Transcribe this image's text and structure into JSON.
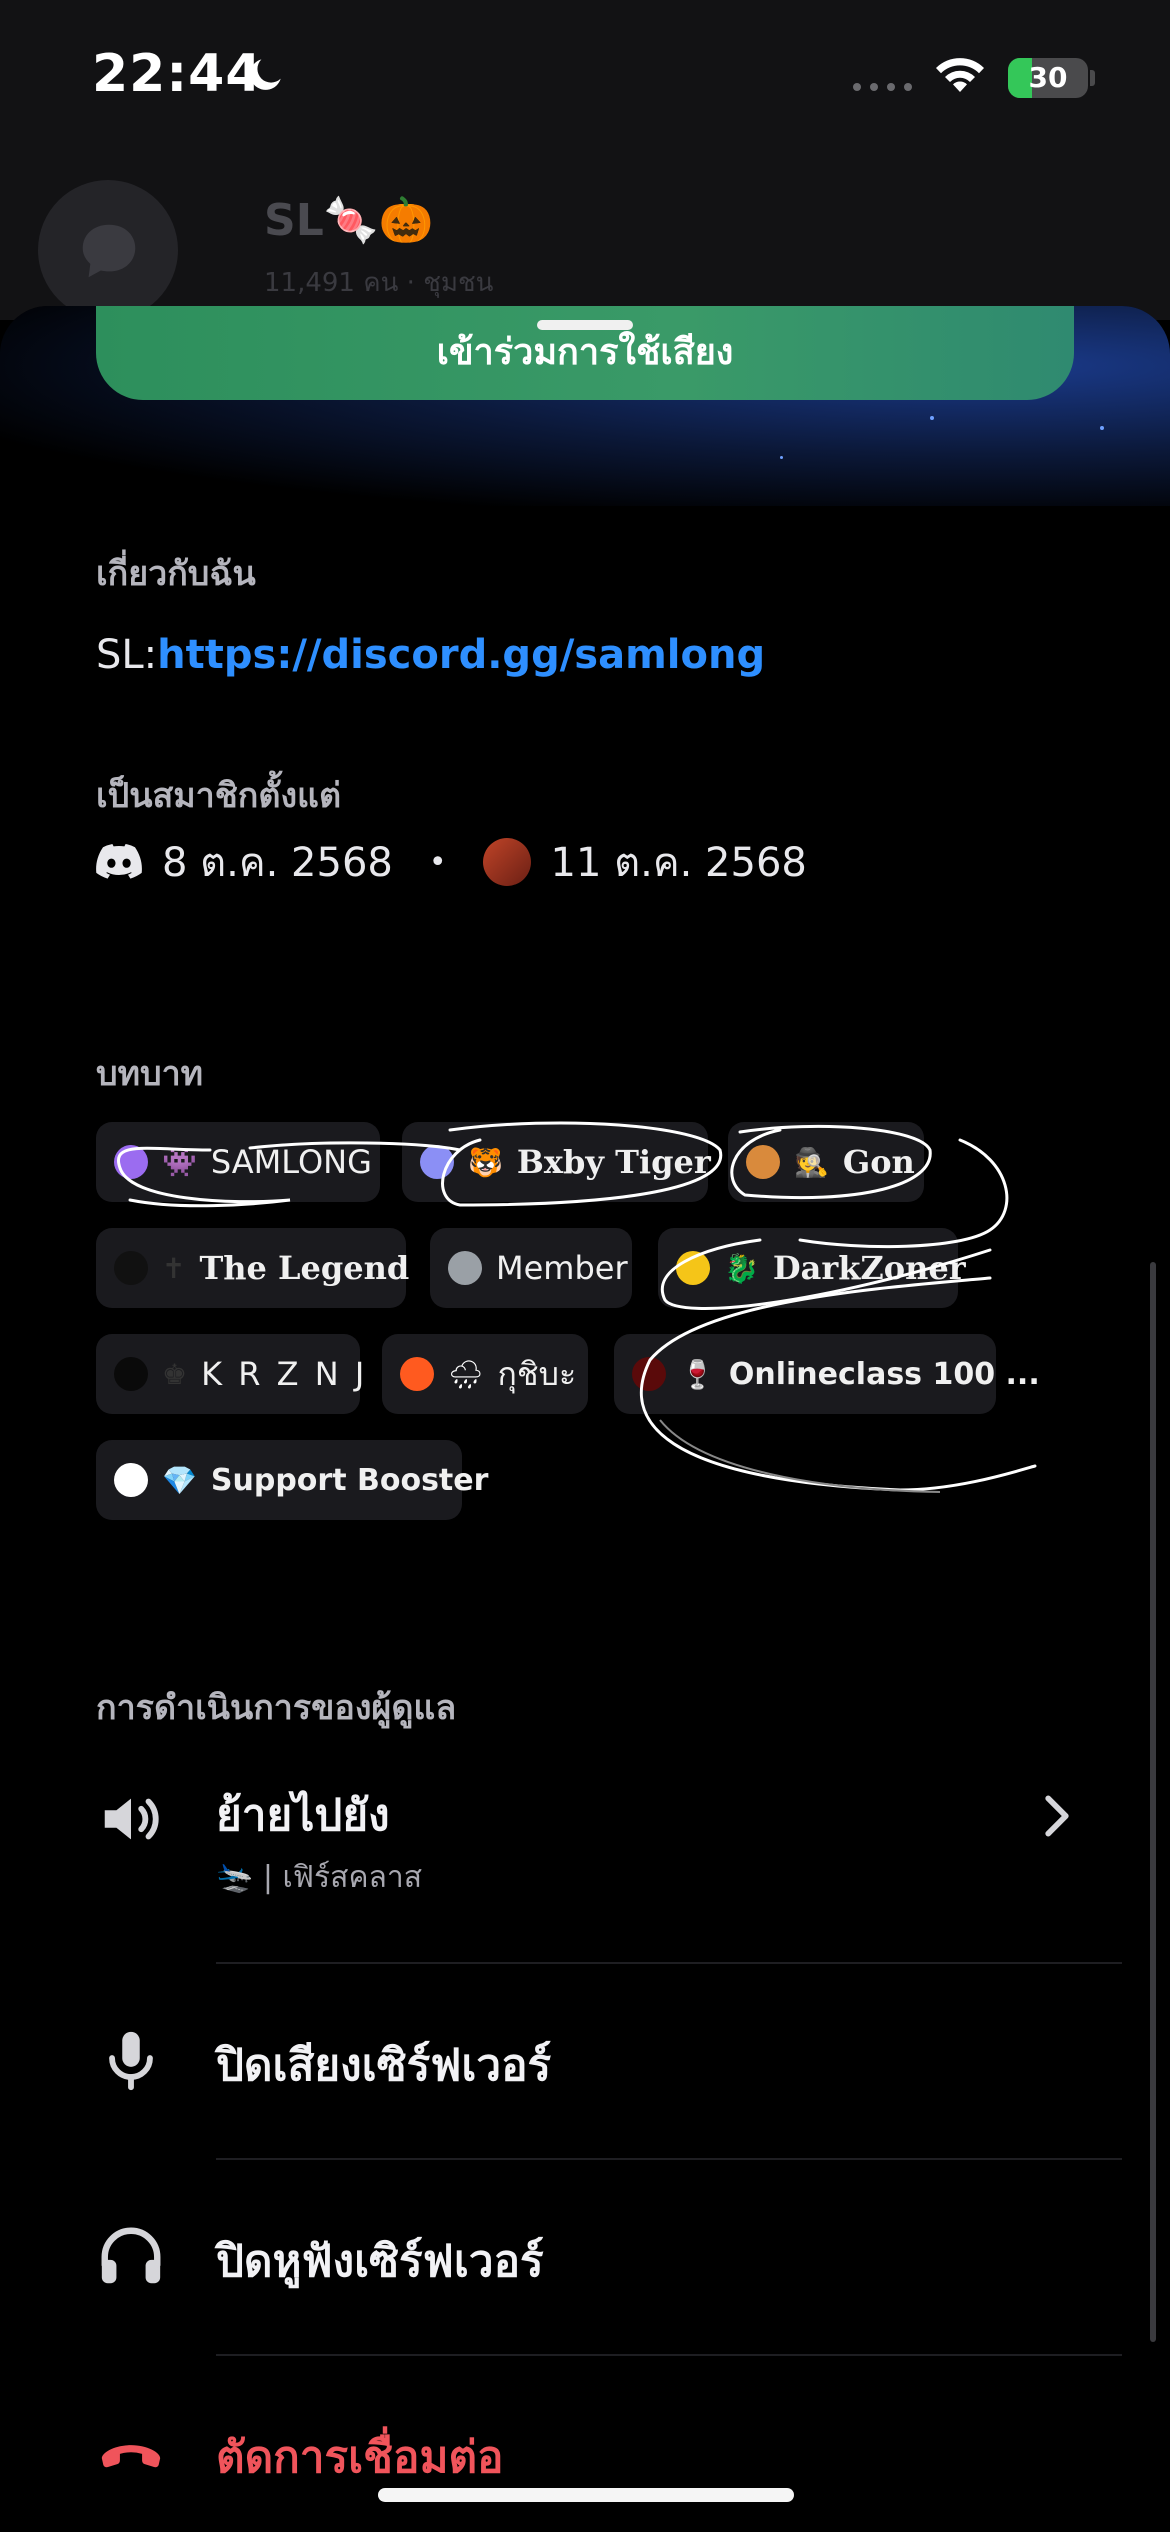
{
  "status_bar": {
    "time": "22:44",
    "battery": "30",
    "battery_level": 0.3
  },
  "background_server": {
    "name": "SL🍬🎃",
    "member_count": "11,491 คน",
    "type": "ชุมชน"
  },
  "join_voice_label": "เข้าร่วมการใช้เสียง",
  "about": {
    "label": "เกี่ยวกับฉัน",
    "prefix": "SL:",
    "link": "https://discord.gg/samlong"
  },
  "member_since": {
    "label": "เป็นสมาชิกตั้งแต่",
    "discord_date": "8 ต.ค. 2568",
    "separator": "•",
    "server_date": "11 ต.ค. 2568"
  },
  "roles": {
    "label": "บทบาท",
    "items": [
      {
        "name": "SAMLONG",
        "color": "#9b6cf0",
        "emoji": "👾"
      },
      {
        "name": "Bxby Tiger",
        "color": "#8b8ff5",
        "emoji": "🐯"
      },
      {
        "name": "Gon",
        "color": "#d98a3c",
        "emoji": "🕵️"
      },
      {
        "name": "The Legend",
        "color": "#111111",
        "emoji": "✝"
      },
      {
        "name": "Member",
        "color": "#9aa0a6",
        "emoji": ""
      },
      {
        "name": "DarkZoner",
        "color": "#f5c518",
        "emoji": "🐉"
      },
      {
        "name": "K R Z N J",
        "color": "#0a0a0a",
        "emoji": "♚"
      },
      {
        "name": "กุชิบะ",
        "color": "#ff5a1f",
        "emoji": "🌧"
      },
      {
        "name": "Onlineclass 100 ...",
        "color": "#5a0a0a",
        "emoji": "🍷"
      },
      {
        "name": "Support Booster",
        "color": "#ffffff",
        "emoji": "💎"
      }
    ]
  },
  "moderator_actions": {
    "label": "การดำเนินการของผู้ดูแล",
    "move_to": {
      "title": "ย้ายไปยัง",
      "subtitle": "🛬 | เฟิร์สคลาส"
    },
    "server_mute": "ปิดเสียงเซิร์ฟเวอร์",
    "server_deafen": "ปิดหูฟังเซิร์ฟเวอร์",
    "disconnect": "ตัดการเชื่อมต่อ"
  },
  "colors": {
    "accent_link": "#2e8fff",
    "danger": "#f0545b",
    "join_green": "#3a9a68"
  },
  "icons": {
    "status": [
      "moon-icon",
      "signal-icon",
      "wifi-icon",
      "battery-icon"
    ],
    "member_since": [
      "discord-icon",
      "server-avatar"
    ],
    "actions": [
      "speaker-icon",
      "chevron-right-icon",
      "microphone-icon",
      "headphones-icon",
      "hang-up-icon"
    ]
  }
}
